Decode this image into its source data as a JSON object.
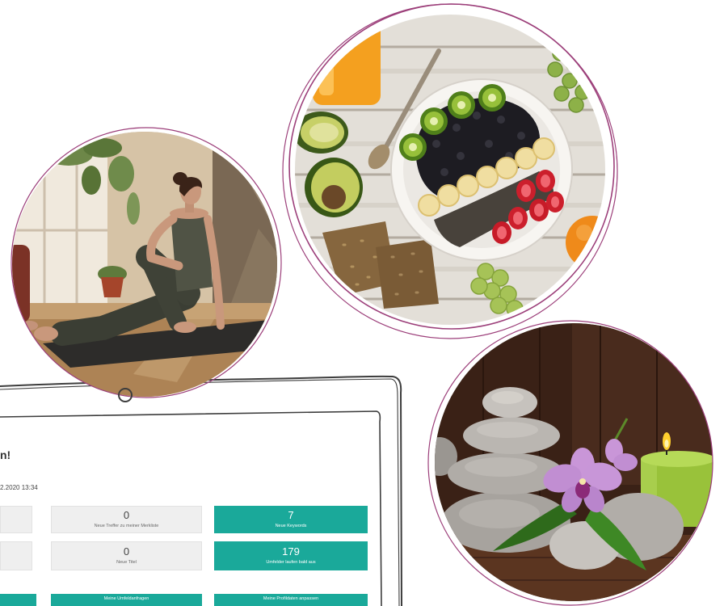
{
  "colors": {
    "accent": "#1aa99a",
    "tile_bg": "#efefef",
    "circle_outline": "#9c3f7a",
    "sketch_line": "#3d3d3d"
  },
  "dashboard": {
    "greeting": "n!",
    "timestamp": "2.2020 13:34",
    "tiles": [
      {
        "value": 0,
        "label": "Neue Treffer zu meiner Merkliste"
      },
      {
        "value": 7,
        "label": "Neue Keywords"
      },
      {
        "value": 0,
        "label": "Neue Titel"
      },
      {
        "value": 179,
        "label": "Umfelder laufen bald aus"
      }
    ],
    "actions": [
      {
        "label": "Meine Umfeldanfragen"
      },
      {
        "label": "Meine Profildaten anpassen"
      }
    ]
  }
}
